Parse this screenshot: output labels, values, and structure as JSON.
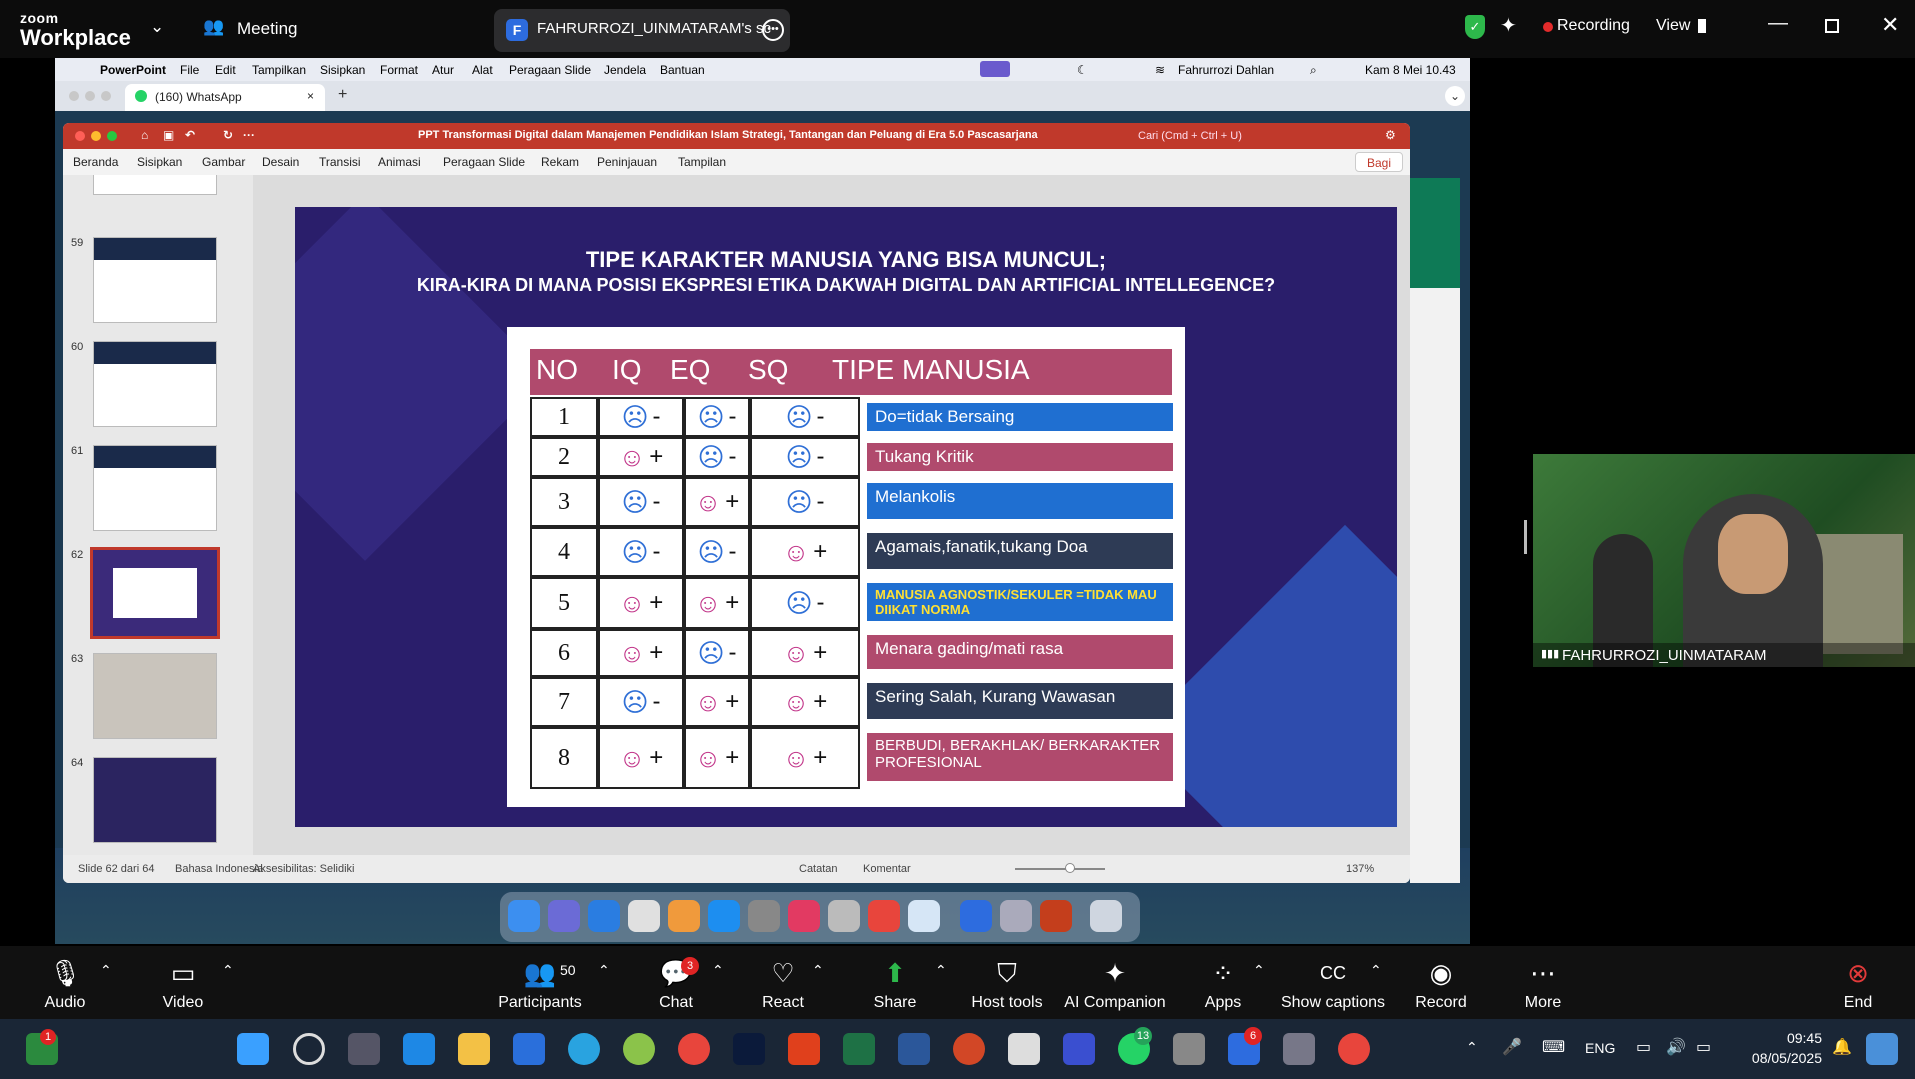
{
  "zoom_top": {
    "logo_line1": "zoom",
    "logo_line2": "Workplace",
    "meeting_label": "Meeting",
    "share_badge": "F",
    "share_title": "FAHRURROZI_UINMATARAM's sc",
    "recording_label": "Recording",
    "view_label": "View"
  },
  "mac_menu": {
    "app": "PowerPoint",
    "items": [
      "File",
      "Edit",
      "Tampilkan",
      "Sisipkan",
      "Format",
      "Atur",
      "Alat",
      "Peragaan Slide",
      "Jendela",
      "Bantuan"
    ],
    "user": "Fahrurrozi Dahlan",
    "datetime": "Kam 8 Mei 10.43"
  },
  "chrome": {
    "tab_title": "(160) WhatsApp",
    "tab_close": "×",
    "new_tab": "+"
  },
  "ppt": {
    "title": "PPT Transformasi Digital dalam Manajemen Pendidikan Islam Strategi, Tantangan dan Peluang di Era 5.0 Pascasarjana",
    "search": "Cari (Cmd + Ctrl + U)",
    "share_button": "Bagi",
    "ribbon": [
      "Beranda",
      "Sisipkan",
      "Gambar",
      "Desain",
      "Transisi",
      "Animasi",
      "Peragaan Slide",
      "Rekam",
      "Peninjauan",
      "Tampilan"
    ],
    "thumb_numbers": [
      "59",
      "60",
      "61",
      "62",
      "63",
      "64"
    ],
    "status": {
      "slide": "Slide 62 dari 64",
      "language": "Bahasa Indonesia",
      "accessibility": "Aksesibilitas: Selidiki",
      "notes": "Catatan",
      "comments": "Komentar",
      "zoom": "137%"
    }
  },
  "slide": {
    "title1": "TIPE KARAKTER MANUSIA YANG BISA MUNCUL;",
    "title2": "KIRA-KIRA DI MANA POSISI EKSPRESI ETIKA DAKWAH DIGITAL DAN ARTIFICIAL INTELLEGENCE?",
    "headers": [
      "NO",
      "IQ",
      "EQ",
      "SQ",
      "TIPE MANUSIA"
    ],
    "rows": [
      {
        "no": "1",
        "iq": "-",
        "eq": "-",
        "sq": "-",
        "type": "Do=tidak Bersaing",
        "color": "#1f6fd1"
      },
      {
        "no": "2",
        "iq": "+",
        "eq": "-",
        "sq": "-",
        "type": "Tukang Kritik",
        "color": "#b04a6d"
      },
      {
        "no": "3",
        "iq": "-",
        "eq": "+",
        "sq": "-",
        "type": "Melankolis",
        "color": "#1f6fd1"
      },
      {
        "no": "4",
        "iq": "-",
        "eq": "-",
        "sq": "+",
        "type": "Agamais,fanatik,tukang Doa",
        "color": "#2e3b55"
      },
      {
        "no": "5",
        "iq": "+",
        "eq": "+",
        "sq": "-",
        "type": "MANUSIA AGNOSTIK/SEKULER =TIDAK MAU DIIKAT NORMA",
        "color": "#1f6fd1"
      },
      {
        "no": "6",
        "iq": "+",
        "eq": "-",
        "sq": "+",
        "type": "Menara gading/mati rasa",
        "color": "#b04a6d"
      },
      {
        "no": "7",
        "iq": "-",
        "eq": "+",
        "sq": "+",
        "type": "Sering Salah, Kurang Wawasan",
        "color": "#2e3b55"
      },
      {
        "no": "8",
        "iq": "+",
        "eq": "+",
        "sq": "+",
        "type": "BERBUDI, BERAKHLAK/ BERKARAKTER PROFESIONAL",
        "color": "#b04a6d"
      }
    ]
  },
  "video": {
    "participant_name": "FAHRURROZI_UINMATARAM"
  },
  "zoom_bottom": {
    "audio": "Audio",
    "video": "Video",
    "participants": "Participants",
    "participants_count": "50",
    "chat": "Chat",
    "chat_badge": "3",
    "react": "React",
    "share": "Share",
    "host_tools": "Host tools",
    "ai_companion": "AI Companion",
    "apps": "Apps",
    "show_captions": "Show captions",
    "record": "Record",
    "more": "More",
    "end": "End"
  },
  "taskbar": {
    "lang": "ENG",
    "time": "09:45",
    "date": "08/05/2025",
    "zoom_badge": "6",
    "whatsapp_badge": "13",
    "widget_badge": "1"
  }
}
